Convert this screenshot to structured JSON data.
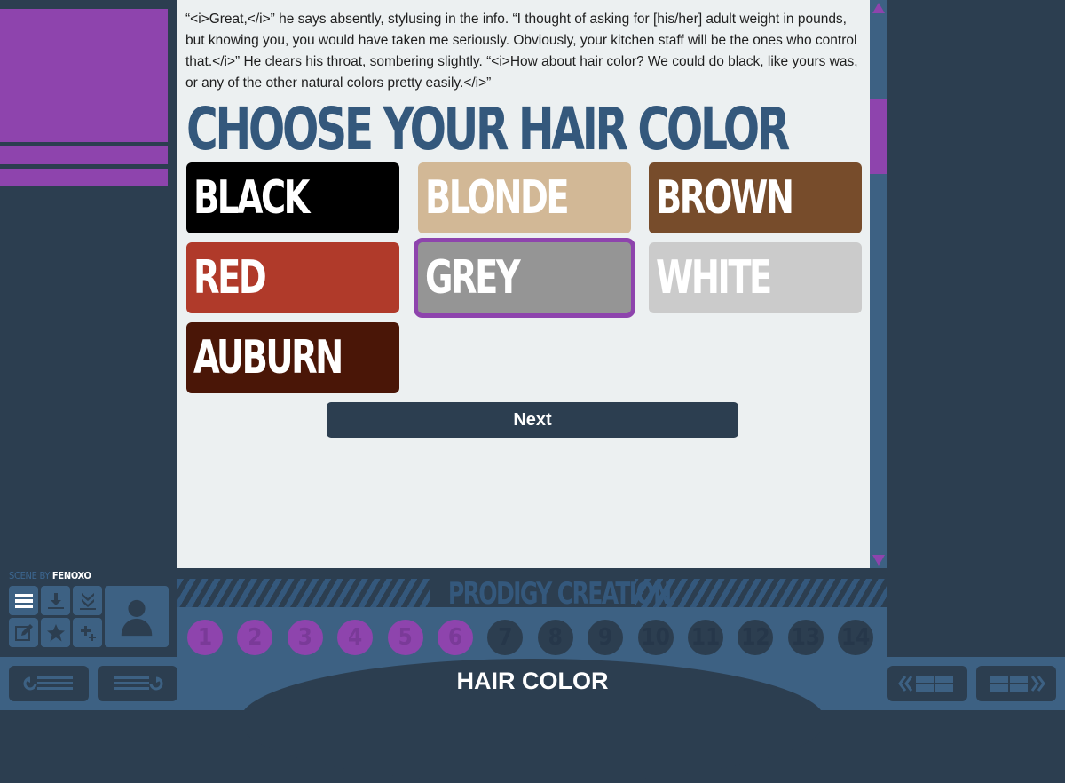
{
  "left_panel": {
    "scene_credit_label": "SCENE BY",
    "scene_credit_author": "FENOXO"
  },
  "story": {
    "text": "“<i>Great,</i>” he says absently, stylusing in the info. “I thought of asking for [his/her] adult weight in pounds, but knowing you, you would have taken me seriously. Obviously, your kitchen staff will be the ones who control that.</i>” He clears his throat, sombering slightly. “<i>How about hair color? We could do black, like yours was, or any of the other natural colors pretty easily.</i>”"
  },
  "choice": {
    "header": "CHOOSE YOUR HAIR COLOR",
    "options": [
      {
        "label": "BLACK",
        "color": "#000000"
      },
      {
        "label": "BLONDE",
        "color": "#d2b896"
      },
      {
        "label": "BROWN",
        "color": "#774c2b"
      },
      {
        "label": "RED",
        "color": "#b03a2a"
      },
      {
        "label": "GREY",
        "color": "#959595",
        "selected": true
      },
      {
        "label": "WHITE",
        "color": "#cbcbcb"
      },
      {
        "label": "AUBURN",
        "color": "#4a1607"
      }
    ],
    "next_label": "Next"
  },
  "progress": {
    "title": "PRODIGY CREATION",
    "steps": [
      "1",
      "2",
      "3",
      "4",
      "5",
      "6",
      "7",
      "8",
      "9",
      "10",
      "11",
      "12",
      "13",
      "14"
    ],
    "completed_steps": 6
  },
  "scene": {
    "title": "HAIR COLOR"
  },
  "colors": {
    "accent": "#8e44ad",
    "panel_dark": "#2c3e50",
    "panel_mid": "#3d6183",
    "header_blue": "#34587c"
  },
  "icons": {
    "toolbar": [
      "menu-icon",
      "save-icon",
      "quicksave-icon",
      "edit-icon",
      "star-icon",
      "perks-icon"
    ],
    "appearance": "person-icon",
    "nav": [
      "back-icon",
      "forward-icon",
      "prev-log-icon",
      "next-log-icon"
    ]
  }
}
